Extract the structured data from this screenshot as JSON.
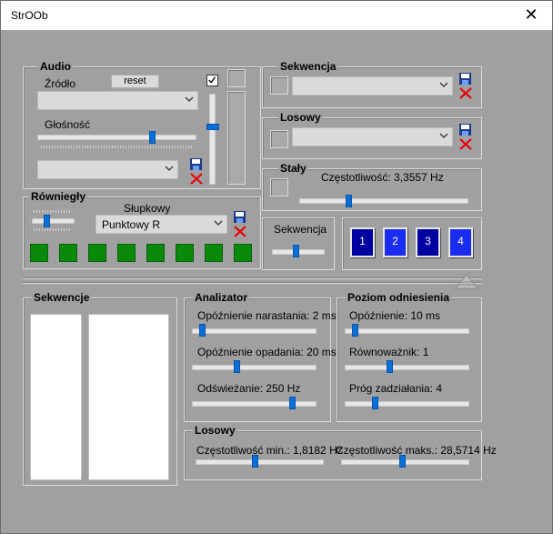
{
  "window": {
    "title": "StrOOb"
  },
  "audio": {
    "title": "Audio",
    "source_label": "Źródło",
    "reset_label": "reset",
    "source_value": "",
    "volume_label": "Głośność",
    "volume_level": 0.74,
    "device_value": "",
    "checkbox_checked": true,
    "vertical_level": 0.35
  },
  "rownolegly": {
    "title": "Równiegły",
    "slupkowy_label": "Słupkowy",
    "mode_value": "Punktowy R",
    "slider_level": 0.3,
    "leds": 8
  },
  "sekwencja": {
    "title": "Sekwencja",
    "value": ""
  },
  "losowy_top": {
    "title": "Losowy",
    "value": ""
  },
  "staly": {
    "title": "Stały",
    "freq_label": "Częstotliwość: 3,3557 Hz",
    "freq_level": 0.28
  },
  "seq_slider": {
    "label": "Sekwencja",
    "level": 0.45
  },
  "num_buttons": [
    "1",
    "2",
    "3",
    "4"
  ],
  "sekwencje": {
    "title": "Sekwencje"
  },
  "analizator": {
    "title": "Analizator",
    "rise_label": "Opóźnienie narastania: 2 ms",
    "rise_level": 0.05,
    "fall_label": "Opóźnienie opadania: 20 ms",
    "fall_level": 0.35,
    "refresh_label": "Odświeżanie: 250 Hz",
    "refresh_level": 0.83
  },
  "poziom": {
    "title": "Poziom odniesienia",
    "delay_label": "Opóźnienie: 10 ms",
    "delay_level": 0.05,
    "balance_label": "Równoważnik: 1",
    "balance_level": 0.35,
    "threshold_label": "Próg zadziałania: 4",
    "threshold_level": 0.22
  },
  "losowy_bottom": {
    "title": "Losowy",
    "min_label": "Częstotliwość min.: 1,8182 Hz",
    "min_level": 0.46,
    "max_label": "Częstotliwość maks.: 28,5714 Hz",
    "max_level": 0.48
  },
  "colors": {
    "led": "#0a8a0a",
    "btn_dark": "#0000a0",
    "btn_light": "#1a2cf0",
    "thumb": "#0a6fd6",
    "delete": "#e8000a"
  }
}
